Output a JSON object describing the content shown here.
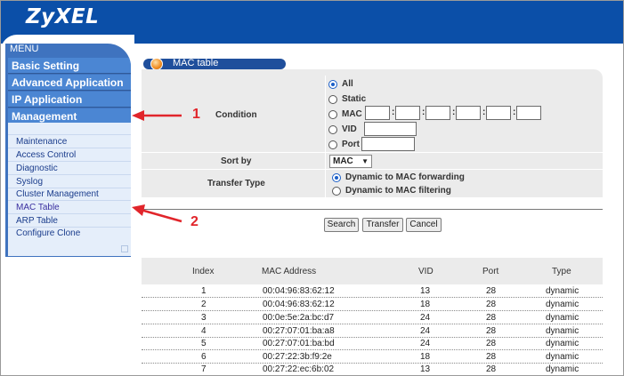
{
  "brand": "ZyXEL",
  "nav": {
    "menu_title": "MENU",
    "sections": [
      "Basic Setting",
      "Advanced Application",
      "IP Application",
      "Management"
    ],
    "sub_items": [
      "Maintenance",
      "Access Control",
      "Diagnostic",
      "Syslog",
      "Cluster Management",
      "MAC Table",
      "ARP Table",
      "Configure Clone"
    ],
    "active_sub_item": "MAC Table"
  },
  "page_title": "MAC table",
  "form": {
    "condition_label": "Condition",
    "condition_options": [
      "All",
      "Static",
      "MAC",
      "VID",
      "Port"
    ],
    "condition_selected": "All",
    "mac_separator": ":",
    "sort_by_label": "Sort by",
    "sort_by_value": "MAC",
    "transfer_type_label": "Transfer Type",
    "transfer_options": [
      "Dynamic to MAC forwarding",
      "Dynamic to MAC filtering"
    ],
    "transfer_selected": "Dynamic to MAC forwarding"
  },
  "buttons": {
    "search": "Search",
    "transfer": "Transfer",
    "cancel": "Cancel"
  },
  "table": {
    "columns": [
      "Index",
      "MAC Address",
      "VID",
      "Port",
      "Type"
    ],
    "rows": [
      [
        "1",
        "00:04:96:83:62:12",
        "13",
        "28",
        "dynamic"
      ],
      [
        "2",
        "00:04:96:83:62:12",
        "18",
        "28",
        "dynamic"
      ],
      [
        "3",
        "00:0e:5e:2a:bc:d7",
        "24",
        "28",
        "dynamic"
      ],
      [
        "4",
        "00:27:07:01:ba:a8",
        "24",
        "28",
        "dynamic"
      ],
      [
        "5",
        "00:27:07:01:ba:bd",
        "24",
        "28",
        "dynamic"
      ],
      [
        "6",
        "00:27:22:3b:f9:2e",
        "18",
        "28",
        "dynamic"
      ],
      [
        "7",
        "00:27:22:ec:6b:02",
        "13",
        "28",
        "dynamic"
      ]
    ]
  },
  "annotations": {
    "arrow1": "1",
    "arrow2": "2"
  },
  "colors": {
    "header": "#0b4fa8",
    "nav": "#3f73bf",
    "annotation": "#e1252b"
  }
}
